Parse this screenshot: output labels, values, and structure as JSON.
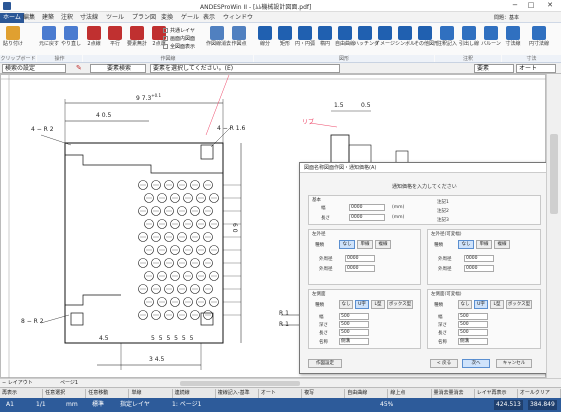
{
  "window": {
    "title": "ANDESProWin II - [ﾑﾑ機械設計図面.pdf]",
    "minimize": "−",
    "maximize": "□",
    "close": "✕",
    "user": "問題：基本"
  },
  "tabs": [
    "ホーム",
    "編集",
    "建築",
    "注釈",
    "寸法線",
    "ツール",
    "プラン図",
    "変換",
    "ゲール",
    "表示",
    "ウィンドウ"
  ],
  "ribbon": {
    "buttons": [
      {
        "label": "貼り付け",
        "color": "#e0a030"
      },
      {
        "label": "元に戻す",
        "color": "#4a7bd0"
      },
      {
        "label": "やり直し",
        "color": "#4a7bd0"
      },
      {
        "label": "2点線",
        "color": "#c03030"
      },
      {
        "label": "平行",
        "color": "#c03030"
      },
      {
        "label": "要素無計",
        "color": "#c03030"
      },
      {
        "label": "2点選",
        "color": "#c03030"
      },
      {
        "label": "作図線消去",
        "color": "#5080c0"
      },
      {
        "label": "作図点",
        "color": "#5080c0"
      },
      {
        "label": "線分",
        "color": "#2060b0"
      },
      {
        "label": "矩形",
        "color": "#2060b0"
      },
      {
        "label": "円・円弧",
        "color": "#2060b0"
      },
      {
        "label": "楕円",
        "color": "#2060b0"
      },
      {
        "label": "自由曲線",
        "color": "#2060b0"
      },
      {
        "label": "ハッチング",
        "color": "#2060b0"
      },
      {
        "label": "イメージ",
        "color": "#2060b0"
      },
      {
        "label": "シンボル",
        "color": "#2060b0"
      },
      {
        "label": "その他図形",
        "color": "#2060b0"
      },
      {
        "label": "注釈記入",
        "color": "#3070c0"
      },
      {
        "label": "引出し線",
        "color": "#3070c0"
      },
      {
        "label": "バルーン",
        "color": "#3070c0"
      },
      {
        "label": "寸法線",
        "color": "#3070c0"
      },
      {
        "label": "円寸法線",
        "color": "#3070c0"
      }
    ],
    "layer_options": [
      "共通レイヤ",
      "画面内図面",
      "全図面表示"
    ],
    "groups": [
      "クリップボード",
      "操作",
      "作図線",
      "図形",
      "注釈",
      "寸法"
    ]
  },
  "optbar": {
    "mode": "検索の設定",
    "search": "要素検索",
    "prompt": "要素を選択してください。(E)",
    "filter": "要素",
    "scope": "オート"
  },
  "drawing": {
    "dim_top": "9 7.3",
    "dim_top_tol": "+0.1",
    "dim_405": "4 0.5",
    "r2_tl": "4 − R 2",
    "r16_tr": "4 − R 1.6",
    "r2_bl": "8 − R 2",
    "dim_60": "6 0",
    "dim_45": "4.5",
    "dim_5s": "5 5 5 5 5 5",
    "dim_345": "3 4.5",
    "right_15": "1.5",
    "right_05": "0.5",
    "right_rib": "リブ",
    "right_r": "R 1",
    "right_r2": "R 1"
  },
  "dialog": {
    "title": "図面名称図面作図・通知価格(A)",
    "heading": "通知価格を入力してください",
    "basic": "基本",
    "w_label": "幅",
    "w_value": "0000",
    "w_unit": "(mm)",
    "d_label": "長さ",
    "d_value": "0000",
    "d_unit": "(mm)",
    "notes": [
      "注記1",
      "注記2",
      "注記3"
    ],
    "left_top": "左外径",
    "right_top": "左外径(可変幅)",
    "type_label": "種類",
    "types1": [
      "なし",
      "単線",
      "複線"
    ],
    "inner_label": "外周径",
    "inner_value": "0000",
    "outer_label": "外周径",
    "outer_value": "0000",
    "left_bottom": "左側面",
    "right_bottom": "左側面(可変幅)",
    "types2": [
      "なし",
      "U字",
      "L型",
      "ボックス型"
    ],
    "wid_label": "幅",
    "wid_value": "500",
    "dep_label": "深さ",
    "dep_value": "500",
    "len_label": "長さ",
    "len_value": "500",
    "name_label": "名称",
    "name_value": "側溝",
    "btn_settings": "作図設定",
    "btn_ok": "OK",
    "btn_prev": "< 戻る",
    "btn_next": "次へ",
    "btn_cancel": "キャンセル"
  },
  "hscroll": {
    "layout": "− レイアウト",
    "page": "ページ1"
  },
  "fkeys": [
    "再表示",
    "任意選択",
    "任意移動",
    "単線",
    "連続線",
    "複線記入-基準",
    "オート",
    "複写",
    "自由曲線",
    "線上点",
    "量消去量消去",
    "レイヤ再表示",
    "オールクリア"
  ],
  "status": {
    "cell": "A1",
    "page": "1/1",
    "unit": "mm",
    "std": "標準",
    "layer_label": "指定レイヤ",
    "layer": "1: ページ1",
    "zoom": "45%",
    "x": "424.513",
    "y": "384.849"
  }
}
